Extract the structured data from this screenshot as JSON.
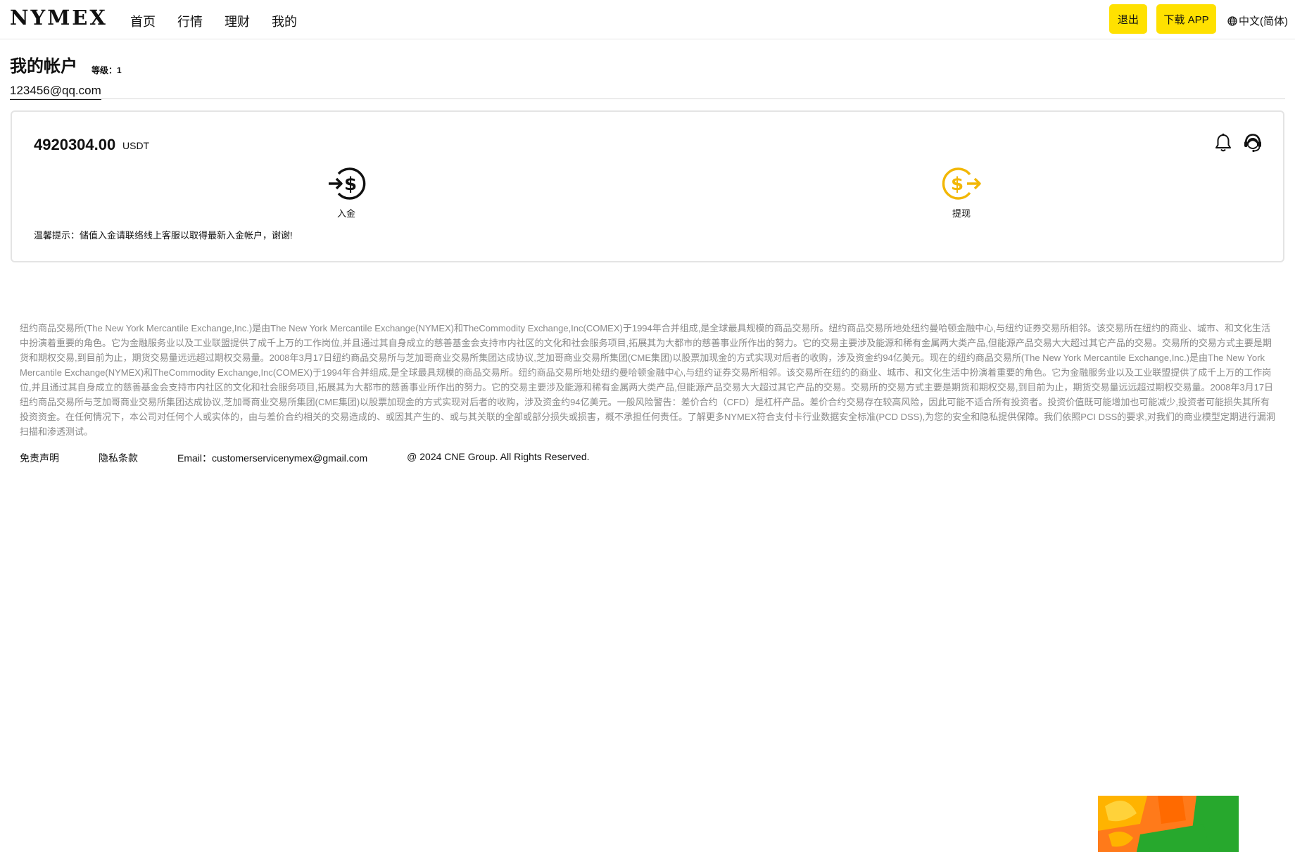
{
  "header": {
    "logo": "NYMEX",
    "nav": [
      "首页",
      "行情",
      "理财",
      "我的"
    ],
    "logout_label": "退出",
    "download_label": "下载 APP",
    "language_label": "中文(简体)",
    "language_icon": "globe-icon"
  },
  "account": {
    "title": "我的帐户",
    "level": "等级：1",
    "email": "123456@qq.com"
  },
  "card": {
    "balance": "4920304.00",
    "currency": "USDT",
    "icons": [
      "bell-icon",
      "customer-service-icon"
    ],
    "deposit_label": "入金",
    "withdraw_label": "提现",
    "tip": "温馨提示：储值入金请联络线上客服以取得最新入金帐户，谢谢!"
  },
  "footer": {
    "disclaimer": "纽约商品交易所(The New York Mercantile Exchange,Inc.)是由The New York Mercantile Exchange(NYMEX)和TheCommodity Exchange,Inc(COMEX)于1994年合并组成,是全球最具规模的商品交易所。纽约商品交易所地处纽约曼哈顿金融中心,与纽约证券交易所相邻。该交易所在纽约的商业、城市、和文化生活中扮演着重要的角色。它为金融服务业以及工业联盟提供了成千上万的工作岗位,并且通过其自身成立的慈善基金会支持市内社区的文化和社会服务项目,拓展其为大都市的慈善事业所作出的努力。它的交易主要涉及能源和稀有金属两大类产品,但能源产品交易大大超过其它产品的交易。交易所的交易方式主要是期货和期权交易,到目前为止，期货交易量远远超过期权交易量。2008年3月17日纽约商品交易所与芝加哥商业交易所集团达成协议,芝加哥商业交易所集团(CME集团)以股票加现金的方式实现对后者的收购，涉及资金约94亿美元。现在的纽约商品交易所(The New York Mercantile Exchange,Inc.)是由The New York Mercantile Exchange(NYMEX)和TheCommodity Exchange,Inc(COMEX)于1994年合并组成,是全球最具规模的商品交易所。纽约商品交易所地处纽约曼哈顿金融中心,与纽约证券交易所相邻。该交易所在纽约的商业、城市、和文化生活中扮演着重要的角色。它为金融服务业以及工业联盟提供了成千上万的工作岗位,并且通过其自身成立的慈善基金会支持市内社区的文化和社会服务项目,拓展其为大都市的慈善事业所作出的努力。它的交易主要涉及能源和稀有金属两大类产品,但能源产品交易大大超过其它产品的交易。交易所的交易方式主要是期货和期权交易,到目前为止，期货交易量远远超过期权交易量。2008年3月17日纽约商品交易所与芝加哥商业交易所集团达成协议,芝加哥商业交易所集团(CME集团)以股票加现金的方式实现对后者的收购，涉及资金约94亿美元。一般风险警告：差价合约（CFD）是杠杆产品。差价合约交易存在较高风险，因此可能不适合所有投资者。投资价值既可能增加也可能减少,投资者可能损失其所有投资资金。在任何情况下，本公司对任何个人或实体的，由与差价合约相关的交易造成的、或因其产生的、或与其关联的全部或部分损失或损害，概不承担任何责任。了解更多NYMEX符合支付卡行业数据安全标准(PCD DSS),为您的安全和隐私提供保障。我们依照PCI DSS的要求,对我们的商业模型定期进行漏洞扫描和渗透测试。",
    "disclaimer_link": "免责声明",
    "privacy_link": "隐私条款",
    "email": "Email：customerservicenymex@gmail.com",
    "copyright": "@ 2024 CNE Group. All Rights Reserved."
  },
  "colors": {
    "accent_yellow": "#ffe100",
    "withdraw_icon": "#f2b705",
    "disclaimer_text": "#8a8a8a"
  }
}
